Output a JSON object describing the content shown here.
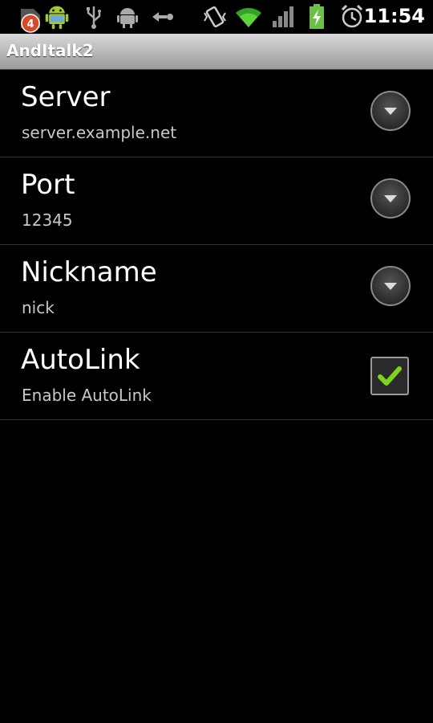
{
  "status_bar": {
    "notification_count": "4",
    "time": "11:54",
    "icons": [
      "notification-badge-icon",
      "android-app-icon",
      "usb-icon",
      "android-debug-icon",
      "sync-arrow-icon",
      "vibrate-icon",
      "wifi-icon",
      "signal-icon",
      "battery-charging-icon",
      "alarm-icon"
    ]
  },
  "app": {
    "title": "AndItalk2"
  },
  "preferences": [
    {
      "title": "Server",
      "summary": "server.example.net",
      "widget": "dropdown-icon"
    },
    {
      "title": "Port",
      "summary": "12345",
      "widget": "dropdown-icon"
    },
    {
      "title": "Nickname",
      "summary": "nick",
      "widget": "dropdown-icon"
    },
    {
      "title": "AutoLink",
      "summary": "Enable AutoLink",
      "widget": "checkbox",
      "checked": true
    }
  ],
  "colors": {
    "check": "#7ed321",
    "title_bar": "#bdbdbd",
    "background": "#000000"
  }
}
